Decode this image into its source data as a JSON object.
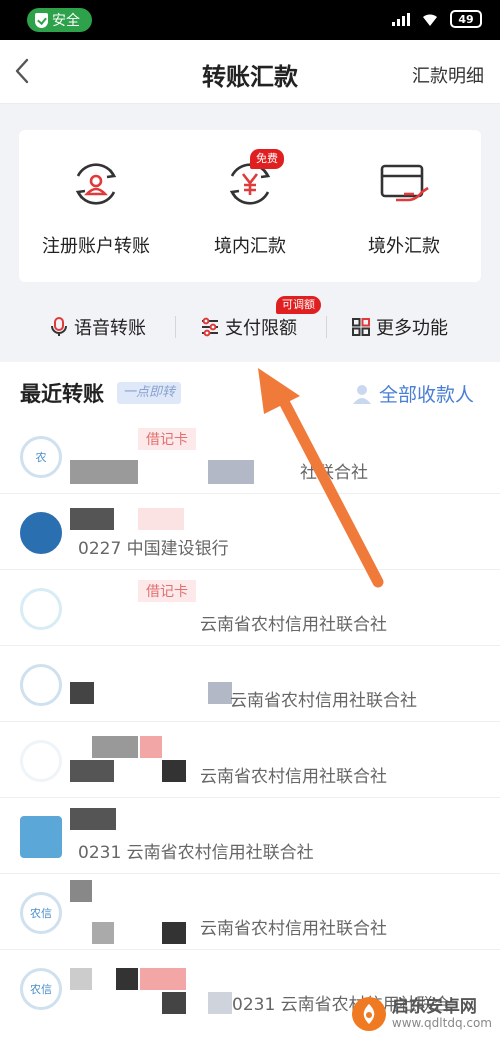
{
  "status_bar": {
    "safe_label": "安全",
    "battery": "49"
  },
  "nav": {
    "title": "转账汇款",
    "right_link": "汇款明细"
  },
  "features": [
    {
      "label": "注册账户转账",
      "icon": "account-transfer-icon"
    },
    {
      "label": "境内汇款",
      "icon": "yen-exchange-icon"
    },
    {
      "label": "境外汇款",
      "icon": "card-hand-icon"
    }
  ],
  "badges": {
    "free": "免费",
    "adjustable": "可调额"
  },
  "quick_actions": [
    {
      "label": "语音转账",
      "icon": "microphone-icon"
    },
    {
      "label": "支付限额",
      "icon": "sliders-icon"
    },
    {
      "label": "更多功能",
      "icon": "grid-icon"
    }
  ],
  "recent": {
    "title": "最近转账",
    "instant": "一点即转",
    "all_payees": "全部收款人"
  },
  "rows": [
    {
      "bank": "社联合社",
      "tag": "借记卡"
    },
    {
      "bank": "0227        中国建设银行",
      "tag": ""
    },
    {
      "bank": "云南省农村信用社联合社",
      "tag": "借记卡"
    },
    {
      "bank": "云南省农村信用社联合社",
      "tag": ""
    },
    {
      "bank": "云南省农村信用社联合社",
      "tag": ""
    },
    {
      "bank": "0231      云南省农村信用社联合社",
      "tag": ""
    },
    {
      "bank": "云南省农村信用社联合社",
      "tag": ""
    },
    {
      "bank": "0231      云南省农村信用社联合",
      "tag": ""
    }
  ],
  "avatar_texts": [
    "农",
    "",
    "",
    "",
    "",
    "",
    "农信",
    "农信"
  ],
  "watermark": {
    "cn": "启东安卓网",
    "en": "www.qdltdq.com"
  },
  "colors": {
    "accent_red": "#e02020",
    "safe_green": "#2ea24a",
    "link_blue": "#4a7fd6",
    "arrow_orange": "#f07a3a"
  }
}
